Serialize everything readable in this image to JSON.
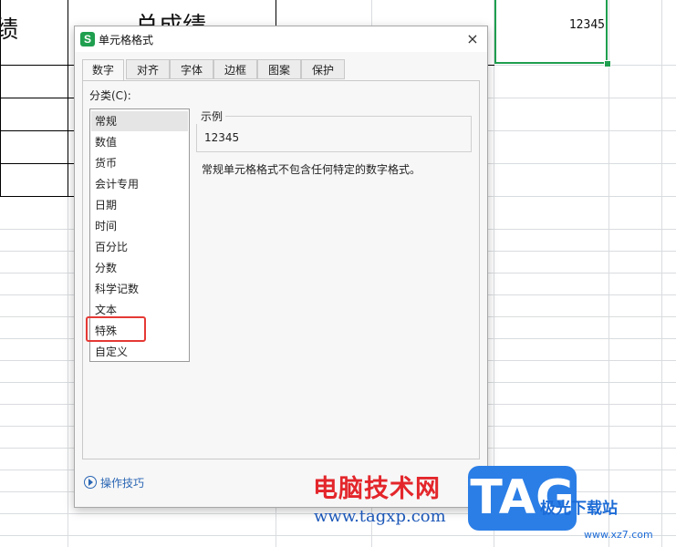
{
  "spreadsheet": {
    "header_left_fragment": "绩",
    "header_center": "总成绩",
    "selected_cell_value": "12345"
  },
  "dialog": {
    "title": "单元格格式",
    "close_label": "×",
    "tabs": [
      {
        "label": "数字",
        "active": true
      },
      {
        "label": "对齐"
      },
      {
        "label": "字体"
      },
      {
        "label": "边框"
      },
      {
        "label": "图案"
      },
      {
        "label": "保护"
      }
    ],
    "category_label": "分类(C):",
    "categories": [
      "常规",
      "数值",
      "货币",
      "会计专用",
      "日期",
      "时间",
      "百分比",
      "分数",
      "科学记数",
      "文本",
      "特殊",
      "自定义"
    ],
    "selected_category": "常规",
    "highlighted_category": "特殊",
    "sample_label": "示例",
    "sample_value": "12345",
    "description": "常规单元格格式不包含任何特定的数字格式。",
    "tips_label": "操作技巧"
  },
  "watermark": {
    "site_name": "电脑技术网",
    "site_url": "www.tagxp.com",
    "tag_logo": "TAG",
    "xz_logo": "极光下载站",
    "xz_url": "www.xz7.com"
  },
  "colors": {
    "selection_green": "#1f9f4f",
    "highlight_red": "#e53935",
    "link_blue": "#2a66b4",
    "tag_blue": "#2b7ee6"
  }
}
